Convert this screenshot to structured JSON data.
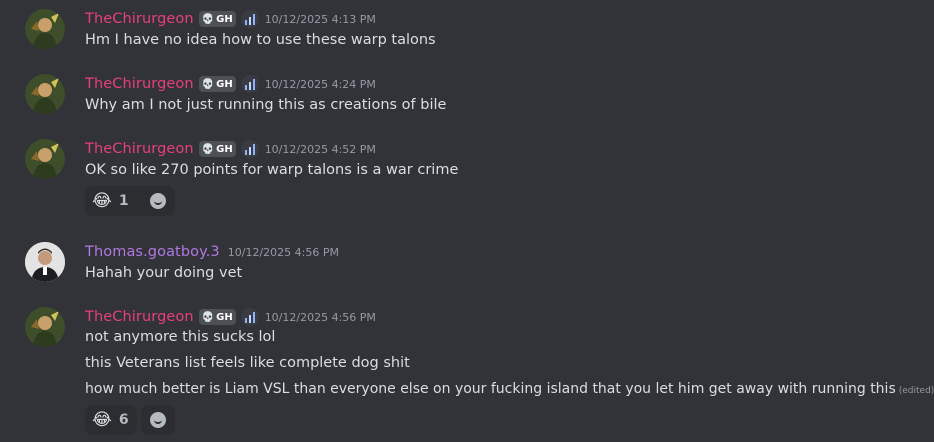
{
  "messages": [
    {
      "username": "TheChirurgeon",
      "tag": "GH",
      "timestamp": "10/12/2025 4:13 PM",
      "lines": [
        "Hm I have no idea how to use these warp talons"
      ]
    },
    {
      "username": "TheChirurgeon",
      "tag": "GH",
      "timestamp": "10/12/2025 4:24 PM",
      "lines": [
        "Why am I not just running this as creations of bile"
      ]
    },
    {
      "username": "TheChirurgeon",
      "tag": "GH",
      "timestamp": "10/12/2025 4:52 PM",
      "lines": [
        "OK so like 270 points for warp talons is a war crime"
      ],
      "reaction": {
        "emoji": "😂",
        "count": "1"
      }
    },
    {
      "username": "Thomas.goatboy.3",
      "timestamp": "10/12/2025 4:56 PM",
      "lines": [
        "Hahah your doing vet"
      ]
    },
    {
      "username": "TheChirurgeon",
      "tag": "GH",
      "timestamp": "10/12/2025 4:56 PM",
      "lines": [
        "not anymore this sucks lol",
        "this Veterans list feels like complete dog shit",
        "how much better is Liam VSL than everyone else on your fucking island that you let him get away with running this"
      ],
      "edited_label": "(edited)",
      "reaction": {
        "emoji": "😂",
        "count": "6"
      }
    }
  ],
  "colors": {
    "background": "#313338",
    "chirurgeon_name": "#e93f7a",
    "thomas_name": "#b178e1",
    "timestamp": "#949ba4",
    "text": "#dbdee1"
  },
  "icons": {
    "tag_icon": "skull-icon",
    "boost_icon": "server-boost-icon",
    "add_reaction": "smiley-icon"
  }
}
